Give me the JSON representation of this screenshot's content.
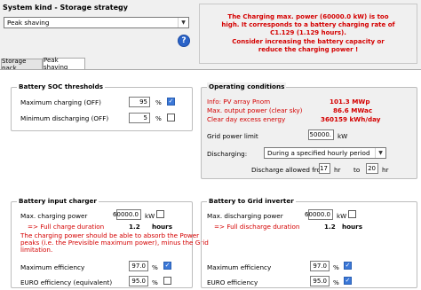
{
  "header": {
    "title": "System kind - Storage strategy",
    "strategy_select": "Peak shaving",
    "help_icon": "?"
  },
  "warning": {
    "line1": "The Charging max. power (60000.0 kW) is too",
    "line2": "high. It corresponds to a battery charging rate of",
    "line3": "C1.129 (1.129 hours).",
    "line4": "Consider increasing the battery capacity or",
    "line5": "reduce the charging power !"
  },
  "tabs": [
    {
      "label": "Storage pack"
    },
    {
      "label": "Peak shaving"
    }
  ],
  "soc": {
    "title": "Battery SOC thresholds",
    "max_label": "Maximum charging  (OFF)",
    "max_value": "95",
    "max_unit": "%",
    "min_label": "Minimum discharging  (OFF)",
    "min_value": "5",
    "min_unit": "%"
  },
  "operating": {
    "title": "Operating conditions",
    "info1_label": "Info: PV array Pnom",
    "info1_value": "101.3 MWp",
    "info2_label": "Max. output power (clear sky)",
    "info2_value": "86.6 MWac",
    "info3_label": "Clear day excess energy",
    "info3_value": "360159 kWh/day",
    "grid_label": "Grid power limit",
    "grid_value": "50000.",
    "grid_unit": "kW",
    "discharging_label": "Discharging:",
    "discharging_select": "During a specified hourly period",
    "allowed_label": "Discharge allowed from",
    "from_value": "17",
    "from_unit": "hr",
    "to_label": "to",
    "to_value": "20",
    "to_unit": "hr"
  },
  "charger": {
    "title": "Battery input charger",
    "power_label": "Max. charging power",
    "power_value": "60000.0",
    "power_unit": "kW",
    "duration_label": "=> Full charge duration",
    "duration_value": "1.2",
    "duration_unit": "hours",
    "note_line1": "The charging power should be able to absorb the Power",
    "note_line2": "peaks (i.e. the Previsible maximum power), minus the Grid",
    "note_line3": "limitation.",
    "max_eff_label": "Maximum efficiency",
    "max_eff_value": "97.0",
    "max_eff_unit": "%",
    "euro_eff_label": "EURO efficiency (equivalent)",
    "euro_eff_value": "95.0",
    "euro_eff_unit": "%"
  },
  "inverter": {
    "title": "Battery to Grid inverter",
    "power_label": "Max. discharging power",
    "power_value": "60000.0",
    "power_unit": "kW",
    "duration_label": "=> Full discharge duration",
    "duration_value": "1.2",
    "duration_unit": "hours",
    "max_eff_label": "Maximum efficiency",
    "max_eff_value": "97.0",
    "max_eff_unit": "%",
    "euro_eff_label": "EURO efficiency",
    "euro_eff_value": "95.0",
    "euro_eff_unit": "%"
  }
}
